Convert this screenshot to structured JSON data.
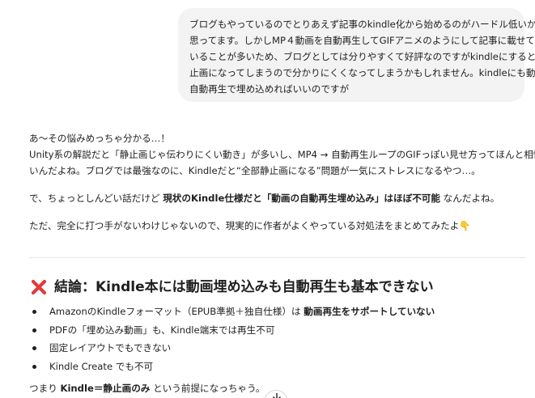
{
  "user_message": {
    "lines": [
      "ブログもやっているのでとりあえず記事のkindle化から始めるのがハードル低いかなと",
      "思ってます。しかしMP４動画を自動再生してGIFアニメのようにして記事に載せて",
      "いることが多いため、ブログとしては分りやすくて好評なのですがkindleにすると静",
      "止画になってしまうので分かりにくくなってしまうかもしれません。kindleにも動画を",
      "自動再生で埋め込めればいいのですが"
    ]
  },
  "reply": {
    "p1_line1": "あ〜その悩みめっちゃ分かる…！",
    "p1_line2": "Unity系の解説だと「静止画じゃ伝わりにくい動き」が多いし、MP4 → 自動再生ループのGIFっぽい見せ方ってほんと相性い",
    "p1_line3": "いんだよね。ブログでは最強なのに、Kindleだと“全部静止画になる”問題が一気にストレスになるやつ…。",
    "p2_pre": "で、ちょっとしんどい話だけど ",
    "p2_bold": "現状のKindle仕様だと「動画の自動再生埋め込み」はほぼ不可能",
    "p2_post": " なんだよね。",
    "p3": "ただ、完全に打つ手がないわけじゃないので、現実的に作者がよくやっている対処法をまとめてみたよ",
    "p3_emoji": "👇"
  },
  "section": {
    "icon": "cross-mark-icon",
    "icon_color": "#e03b3b",
    "heading": "結論：Kindle本には動画埋め込みも自動再生も基本できない"
  },
  "bullets": {
    "b1_pre": "AmazonのKindleフォーマット（EPUB準拠＋独自仕様）は ",
    "b1_bold": "動画再生をサポートしていない",
    "b2": "PDFの「埋め込み動画」も、Kindle端末では再生不可",
    "b3": "固定レイアウトでもできない",
    "b4": "Kindle Create でも不可"
  },
  "summary": {
    "pre": "つまり ",
    "bold": "Kindle＝静止画のみ",
    "post": " という前提になっちゃう。"
  },
  "scroll_button": {
    "icon": "arrow-down-icon"
  }
}
